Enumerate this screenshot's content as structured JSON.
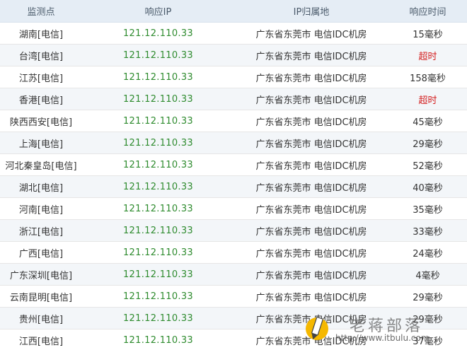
{
  "header": {
    "col_point": "监测点",
    "col_ip": "响应IP",
    "col_location": "IP归属地",
    "col_time": "响应时间"
  },
  "rows": [
    {
      "point": "湖南[电信]",
      "ip": "121.12.110.33",
      "location": "广东省东莞市 电信IDC机房",
      "time": "15毫秒",
      "timeout": false
    },
    {
      "point": "台湾[电信]",
      "ip": "121.12.110.33",
      "location": "广东省东莞市 电信IDC机房",
      "time": "超时",
      "timeout": true
    },
    {
      "point": "江苏[电信]",
      "ip": "121.12.110.33",
      "location": "广东省东莞市 电信IDC机房",
      "time": "158毫秒",
      "timeout": false
    },
    {
      "point": "香港[电信]",
      "ip": "121.12.110.33",
      "location": "广东省东莞市 电信IDC机房",
      "time": "超时",
      "timeout": true
    },
    {
      "point": "陕西西安[电信]",
      "ip": "121.12.110.33",
      "location": "广东省东莞市 电信IDC机房",
      "time": "45毫秒",
      "timeout": false
    },
    {
      "point": "上海[电信]",
      "ip": "121.12.110.33",
      "location": "广东省东莞市 电信IDC机房",
      "time": "29毫秒",
      "timeout": false
    },
    {
      "point": "河北秦皇岛[电信]",
      "ip": "121.12.110.33",
      "location": "广东省东莞市 电信IDC机房",
      "time": "52毫秒",
      "timeout": false
    },
    {
      "point": "湖北[电信]",
      "ip": "121.12.110.33",
      "location": "广东省东莞市 电信IDC机房",
      "time": "40毫秒",
      "timeout": false
    },
    {
      "point": "河南[电信]",
      "ip": "121.12.110.33",
      "location": "广东省东莞市 电信IDC机房",
      "time": "35毫秒",
      "timeout": false
    },
    {
      "point": "浙江[电信]",
      "ip": "121.12.110.33",
      "location": "广东省东莞市 电信IDC机房",
      "time": "33毫秒",
      "timeout": false
    },
    {
      "point": "广西[电信]",
      "ip": "121.12.110.33",
      "location": "广东省东莞市 电信IDC机房",
      "time": "24毫秒",
      "timeout": false
    },
    {
      "point": "广东深圳[电信]",
      "ip": "121.12.110.33",
      "location": "广东省东莞市 电信IDC机房",
      "time": "4毫秒",
      "timeout": false
    },
    {
      "point": "云南昆明[电信]",
      "ip": "121.12.110.33",
      "location": "广东省东莞市 电信IDC机房",
      "time": "29毫秒",
      "timeout": false
    },
    {
      "point": "贵州[电信]",
      "ip": "121.12.110.33",
      "location": "广东省东莞市 电信IDC机房",
      "time": "29毫秒",
      "timeout": false
    },
    {
      "point": "江西[电信]",
      "ip": "121.12.110.33",
      "location": "广东省东莞市 电信IDC机房",
      "time": "37毫秒",
      "timeout": false
    }
  ],
  "colors": {
    "ip_text": "#2e8b2e",
    "timeout_text": "#d42020",
    "header_bg": "#e5edf5",
    "stripe_bg": "#f3f6f9"
  },
  "watermark": {
    "title": "老蒋部落",
    "url": "http://www.itbulu.com",
    "logo_icon": "pencil-badge-icon"
  }
}
